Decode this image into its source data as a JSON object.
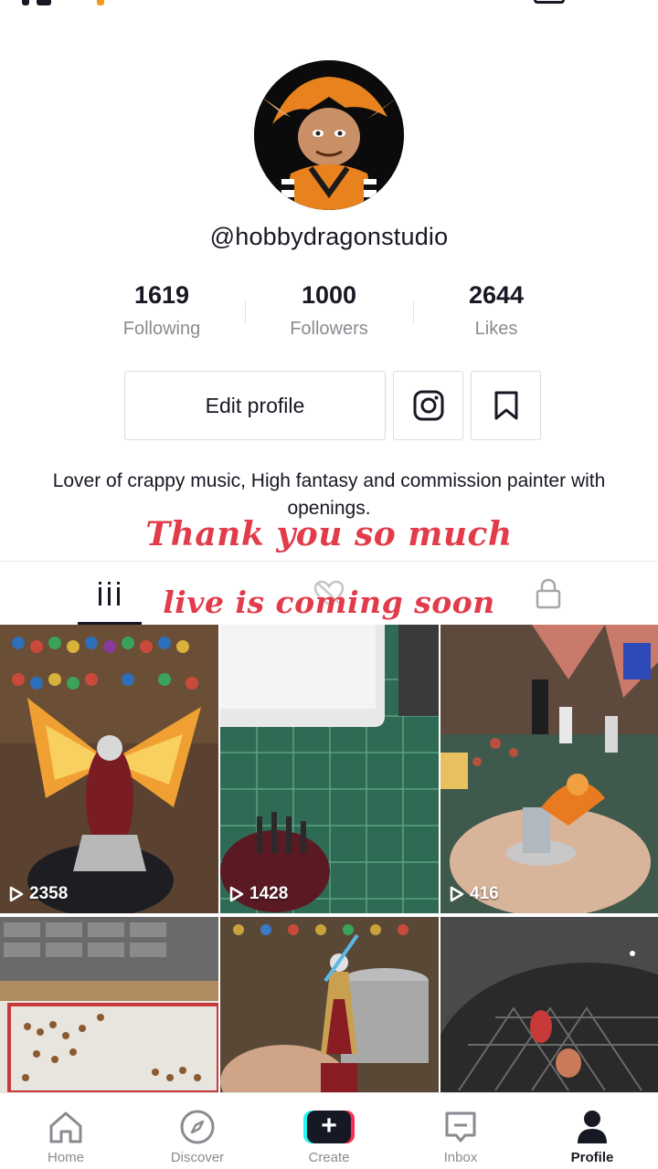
{
  "profile": {
    "username": "@hobbydragonstudio",
    "bio": "Lover of crappy music, High fantasy and commission painter with openings."
  },
  "stats": [
    {
      "value": "1619",
      "label": "Following"
    },
    {
      "value": "1000",
      "label": "Followers"
    },
    {
      "value": "2644",
      "label": "Likes"
    }
  ],
  "actions": {
    "edit_profile_label": "Edit profile",
    "instagram_icon": "instagram-icon",
    "bookmark_icon": "bookmark-icon"
  },
  "overlay": {
    "line1": "Thank you so much",
    "line2": "live is coming soon"
  },
  "tabs": [
    {
      "icon": "videos-grid-icon",
      "active": true
    },
    {
      "icon": "liked-hidden-icon",
      "active": false
    },
    {
      "icon": "lock-icon",
      "active": false
    }
  ],
  "videos": [
    {
      "views": "2358"
    },
    {
      "views": "1428"
    },
    {
      "views": "416"
    },
    {
      "views": ""
    },
    {
      "views": ""
    },
    {
      "views": ""
    }
  ],
  "bottom_nav": [
    {
      "label": "Home",
      "icon": "home-icon",
      "active": false
    },
    {
      "label": "Discover",
      "icon": "compass-icon",
      "active": false
    },
    {
      "label": "Create",
      "icon": "plus-icon",
      "active": false
    },
    {
      "label": "Inbox",
      "icon": "inbox-icon",
      "active": false
    },
    {
      "label": "Profile",
      "icon": "person-icon",
      "active": true
    }
  ],
  "colors": {
    "text": "#161823",
    "secondary_text": "#8a8b91",
    "overlay_text": "#e23b4a",
    "create_cyan": "#25f4ee",
    "create_pink": "#fe2c55"
  }
}
